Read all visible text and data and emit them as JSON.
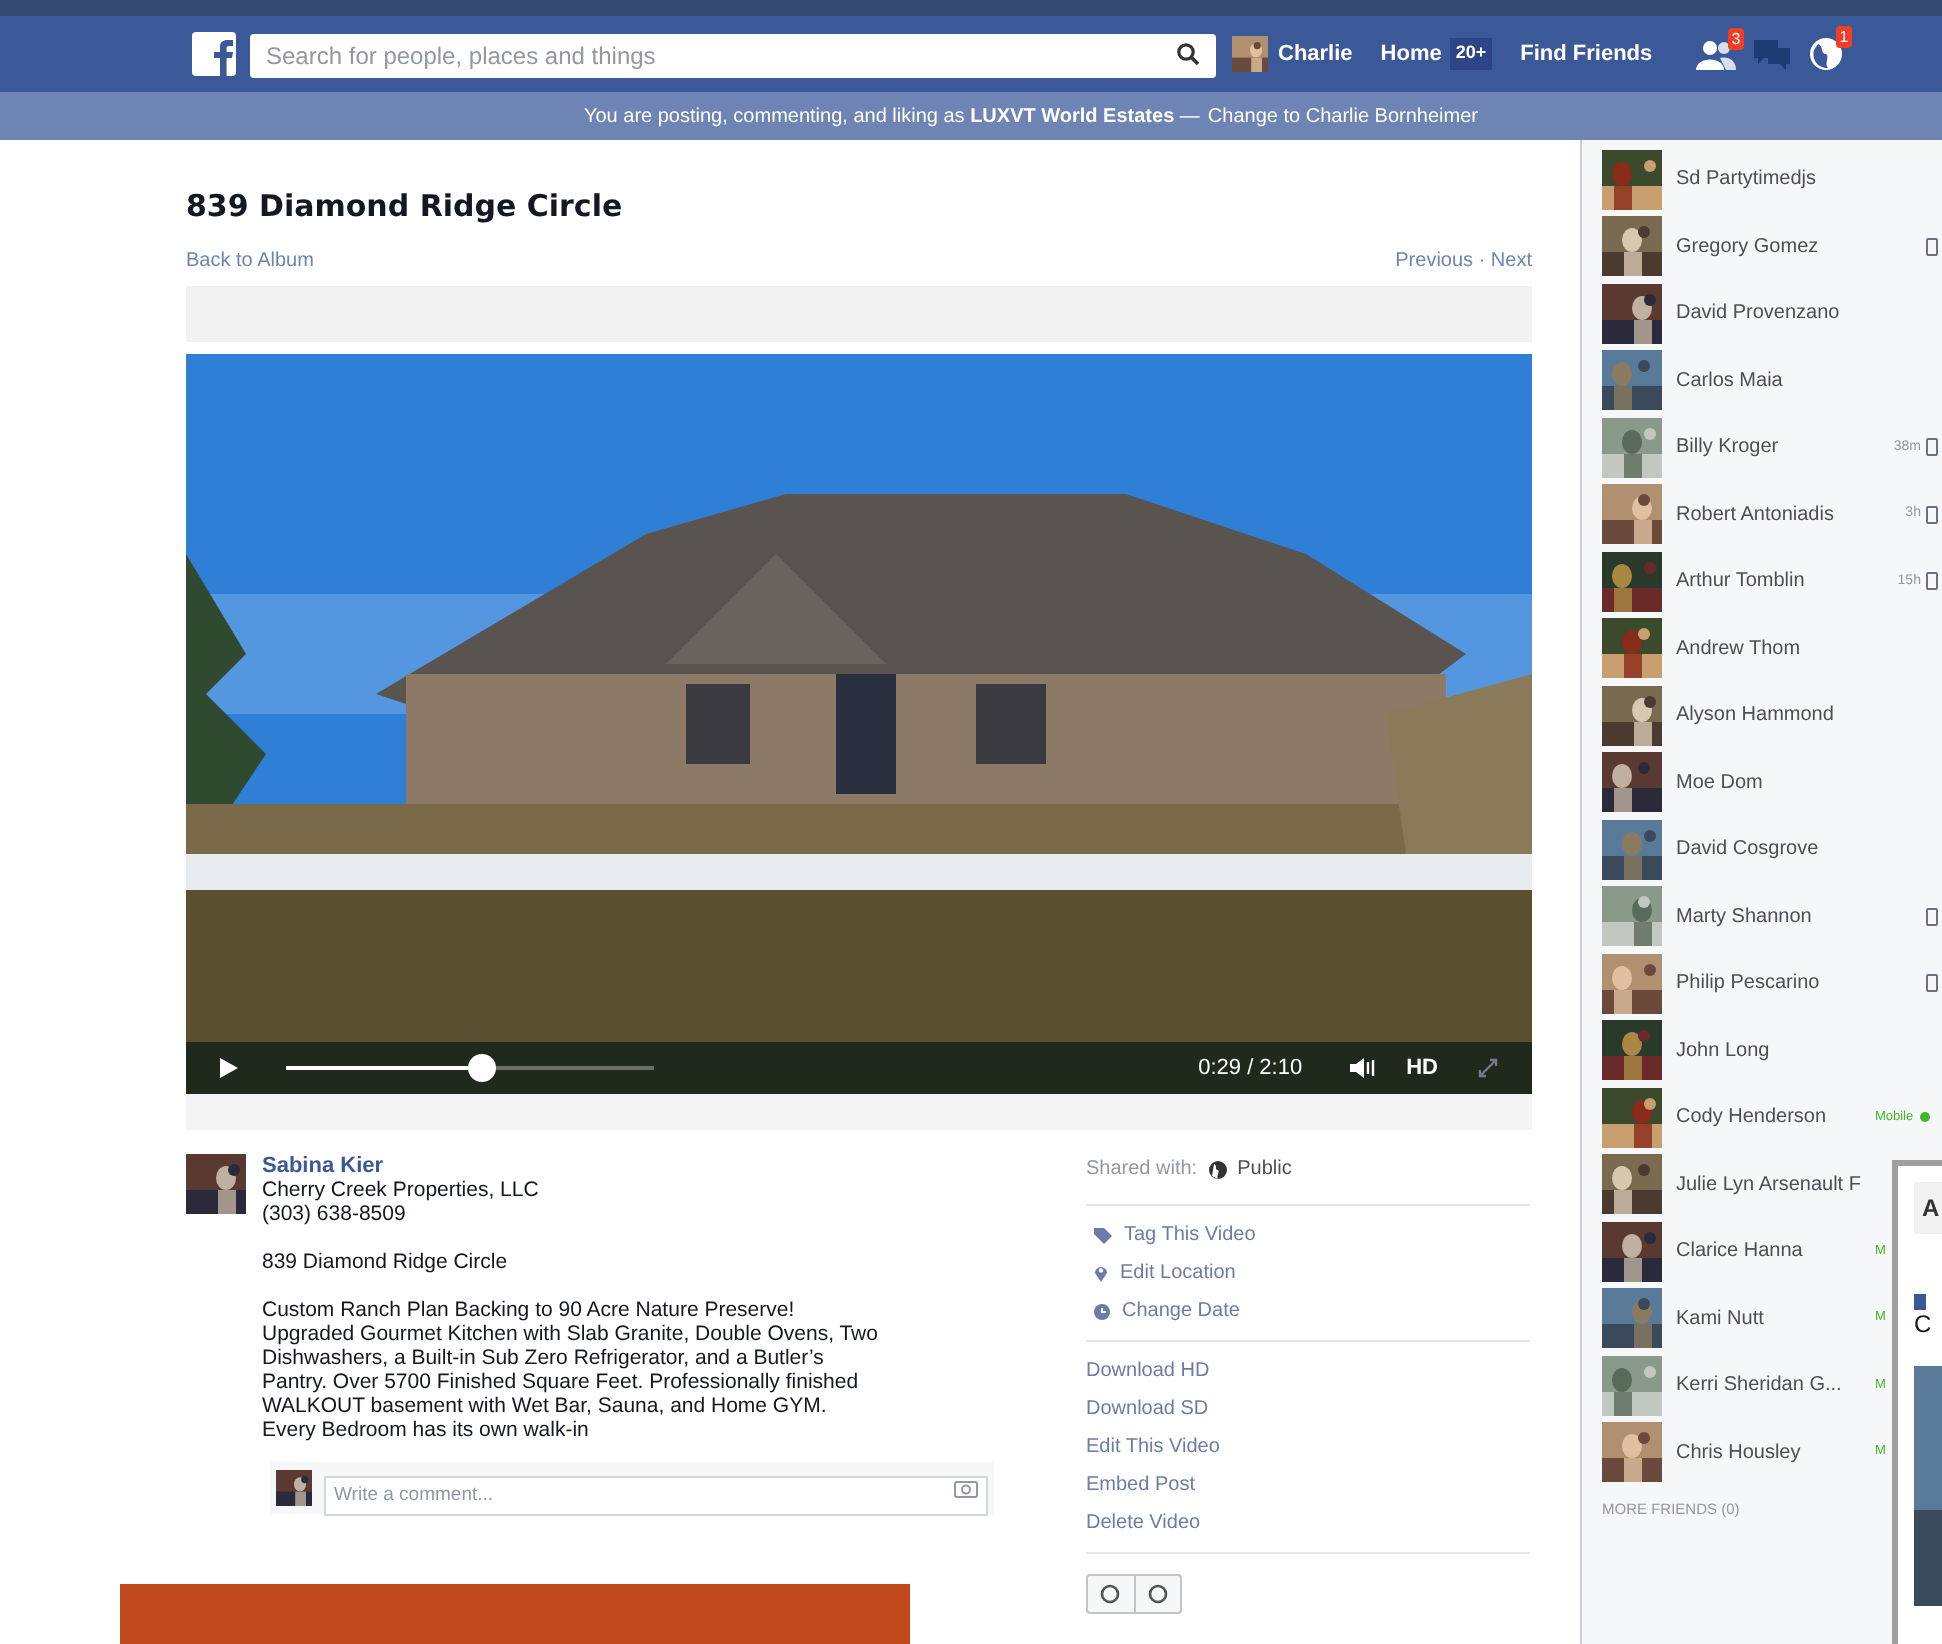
{
  "topbar": {
    "search": {
      "placeholder": "Search for people, places and things"
    },
    "user": "Charlie",
    "home": {
      "label": "Home",
      "count": "20+"
    },
    "find_friends": "Find Friends",
    "notifications": [
      {
        "kind": "friends",
        "badge": "3"
      },
      {
        "kind": "messages"
      },
      {
        "kind": "globe",
        "badge": "1"
      }
    ]
  },
  "notice": {
    "text": "You are posting, commenting, and liking as **LUXVT World Estates** —",
    "link": "Change to Charlie Bornheimer"
  },
  "title": "839 Diamond Ridge Circle",
  "back_link": "Back to Album",
  "pager": "Previous · Next",
  "video": {
    "time": "0:29 / 2:10",
    "level": 0.53,
    "hd": "HD"
  },
  "post": {
    "author": "Sabina Kier",
    "lines": [
      "Cherry Creek Properties, LLC",
      "(303) 638-8509"
    ],
    "paragraphs": [
      "839 Diamond Ridge Circle",
      "Custom Ranch Plan Backing to 90 Acre Nature Preserve! Upgraded Gourmet Kitchen with Slab Granite, Double Ovens, Two Dishwashers, a Built-in Sub Zero Refrigerator, and a Butler’s Pantry. Over 5700 Finished Square Feet. Professionally finished WALKOUT basement with Wet Bar, Sauna, and Home GYM. Every Bedroom has its own walk-in"
    ],
    "comment": {
      "placeholder": "Write a comment..."
    }
  },
  "side": {
    "shared_label": "Shared with:",
    "audience": "Public",
    "actions": [
      {
        "kind": "tag",
        "label": "Tag This Video"
      },
      {
        "kind": "location",
        "label": "Edit Location"
      },
      {
        "kind": "date",
        "label": "Change Date"
      }
    ],
    "links": [
      "Download HD",
      "Download SD",
      "Edit This Video",
      "Embed Post",
      "Delete Video"
    ]
  },
  "chat": {
    "friends": [
      {
        "name": "Sd Partytimedjs"
      },
      {
        "name": "Gregory Gomez",
        "device": true
      },
      {
        "name": "David Provenzano"
      },
      {
        "name": "Carlos Maia"
      },
      {
        "name": "Billy Kroger",
        "time": "38m",
        "device": true
      },
      {
        "name": "Robert Antoniadis",
        "time": "3h",
        "device": true
      },
      {
        "name": "Arthur Tomblin",
        "time": "15h",
        "device": true
      },
      {
        "name": "Andrew Thom"
      },
      {
        "name": "Alyson Hammond"
      },
      {
        "name": "Moe Dom"
      },
      {
        "name": "David Cosgrove"
      },
      {
        "name": "Marty Shannon",
        "device": true
      },
      {
        "name": "Philip Pescarino",
        "device": true
      },
      {
        "name": "John Long"
      },
      {
        "name": "Cody Henderson",
        "mobile": "Mobile",
        "online": true
      },
      {
        "name": "Julie Lyn Arsenault F"
      },
      {
        "name": "Clarice Hanna",
        "mobile": "M"
      },
      {
        "name": "Kami Nutt",
        "mobile": "M"
      },
      {
        "name": "Kerri Sheridan G...",
        "mobile": "M"
      },
      {
        "name": "Chris Housley",
        "mobile": "M"
      }
    ],
    "more": "MORE FRIENDS (0)"
  },
  "popup": {
    "header": "A",
    "line": "C"
  }
}
